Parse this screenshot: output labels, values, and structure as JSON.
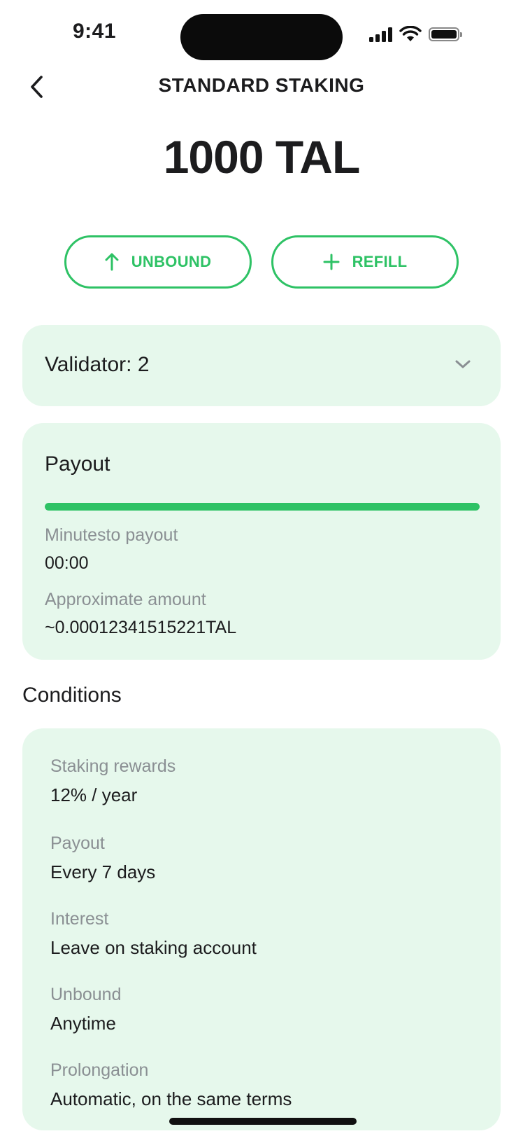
{
  "status_bar": {
    "time": "9:41"
  },
  "header": {
    "title": "STANDARD STAKING"
  },
  "balance": "1000 TAL",
  "actions": {
    "unbound_label": "UNBOUND",
    "refill_label": "REFILL"
  },
  "validator": {
    "label": "Validator: 2"
  },
  "payout": {
    "title": "Payout",
    "progress": 1.0,
    "minutes_label": "Minutesto payout",
    "minutes_value": "00:00",
    "amount_label": "Approximate amount",
    "amount_value": "~0.00012341515221TAL"
  },
  "conditions": {
    "title": "Conditions",
    "items": [
      {
        "label": "Staking rewards",
        "value": "12% / year"
      },
      {
        "label": "Payout",
        "value": "Every 7 days"
      },
      {
        "label": "Interest",
        "value": "Leave on staking account"
      },
      {
        "label": "Unbound",
        "value": "Anytime"
      },
      {
        "label": "Prolongation",
        "value": "Automatic, on the same terms"
      }
    ]
  },
  "colors": {
    "accent": "#2ec265",
    "card_bg": "#e6f8ec",
    "muted_text": "#8a8f93",
    "text": "#1c1c1e"
  }
}
